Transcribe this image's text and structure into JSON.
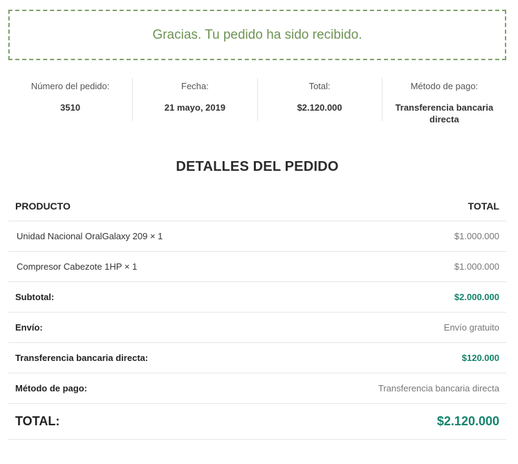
{
  "notice": {
    "text": "Gracias. Tu pedido ha sido recibido."
  },
  "overview": [
    {
      "label": "Número del pedido:",
      "value": "3510"
    },
    {
      "label": "Fecha:",
      "value": "21 mayo, 2019"
    },
    {
      "label": "Total:",
      "value": "$2.120.000"
    },
    {
      "label": "Método de pago:",
      "value": "Transferencia bancaria directa"
    }
  ],
  "details": {
    "title": "DETALLES DEL PEDIDO",
    "header": {
      "product": "PRODUCTO",
      "total": "TOTAL"
    },
    "items": [
      {
        "name": "Unidad Nacional OralGalaxy 209",
        "qty": "× 1",
        "total": "$1.000.000"
      },
      {
        "name": "Compresor Cabezote 1HP",
        "qty": "× 1",
        "total": "$1.000.000"
      }
    ],
    "subtotal": {
      "label": "Subtotal:",
      "value": "$2.000.000"
    },
    "shipping": {
      "label": "Envío:",
      "value": "Envío gratuito"
    },
    "fee": {
      "label": "Transferencia bancaria directa:",
      "value": "$120.000"
    },
    "payment": {
      "label": "Método de pago:",
      "value": "Transferencia bancaria directa"
    },
    "grand_total": {
      "label": "TOTAL:",
      "value": "$2.120.000"
    }
  },
  "colors": {
    "notice_green": "#6e9455",
    "price_green": "#14836b"
  }
}
